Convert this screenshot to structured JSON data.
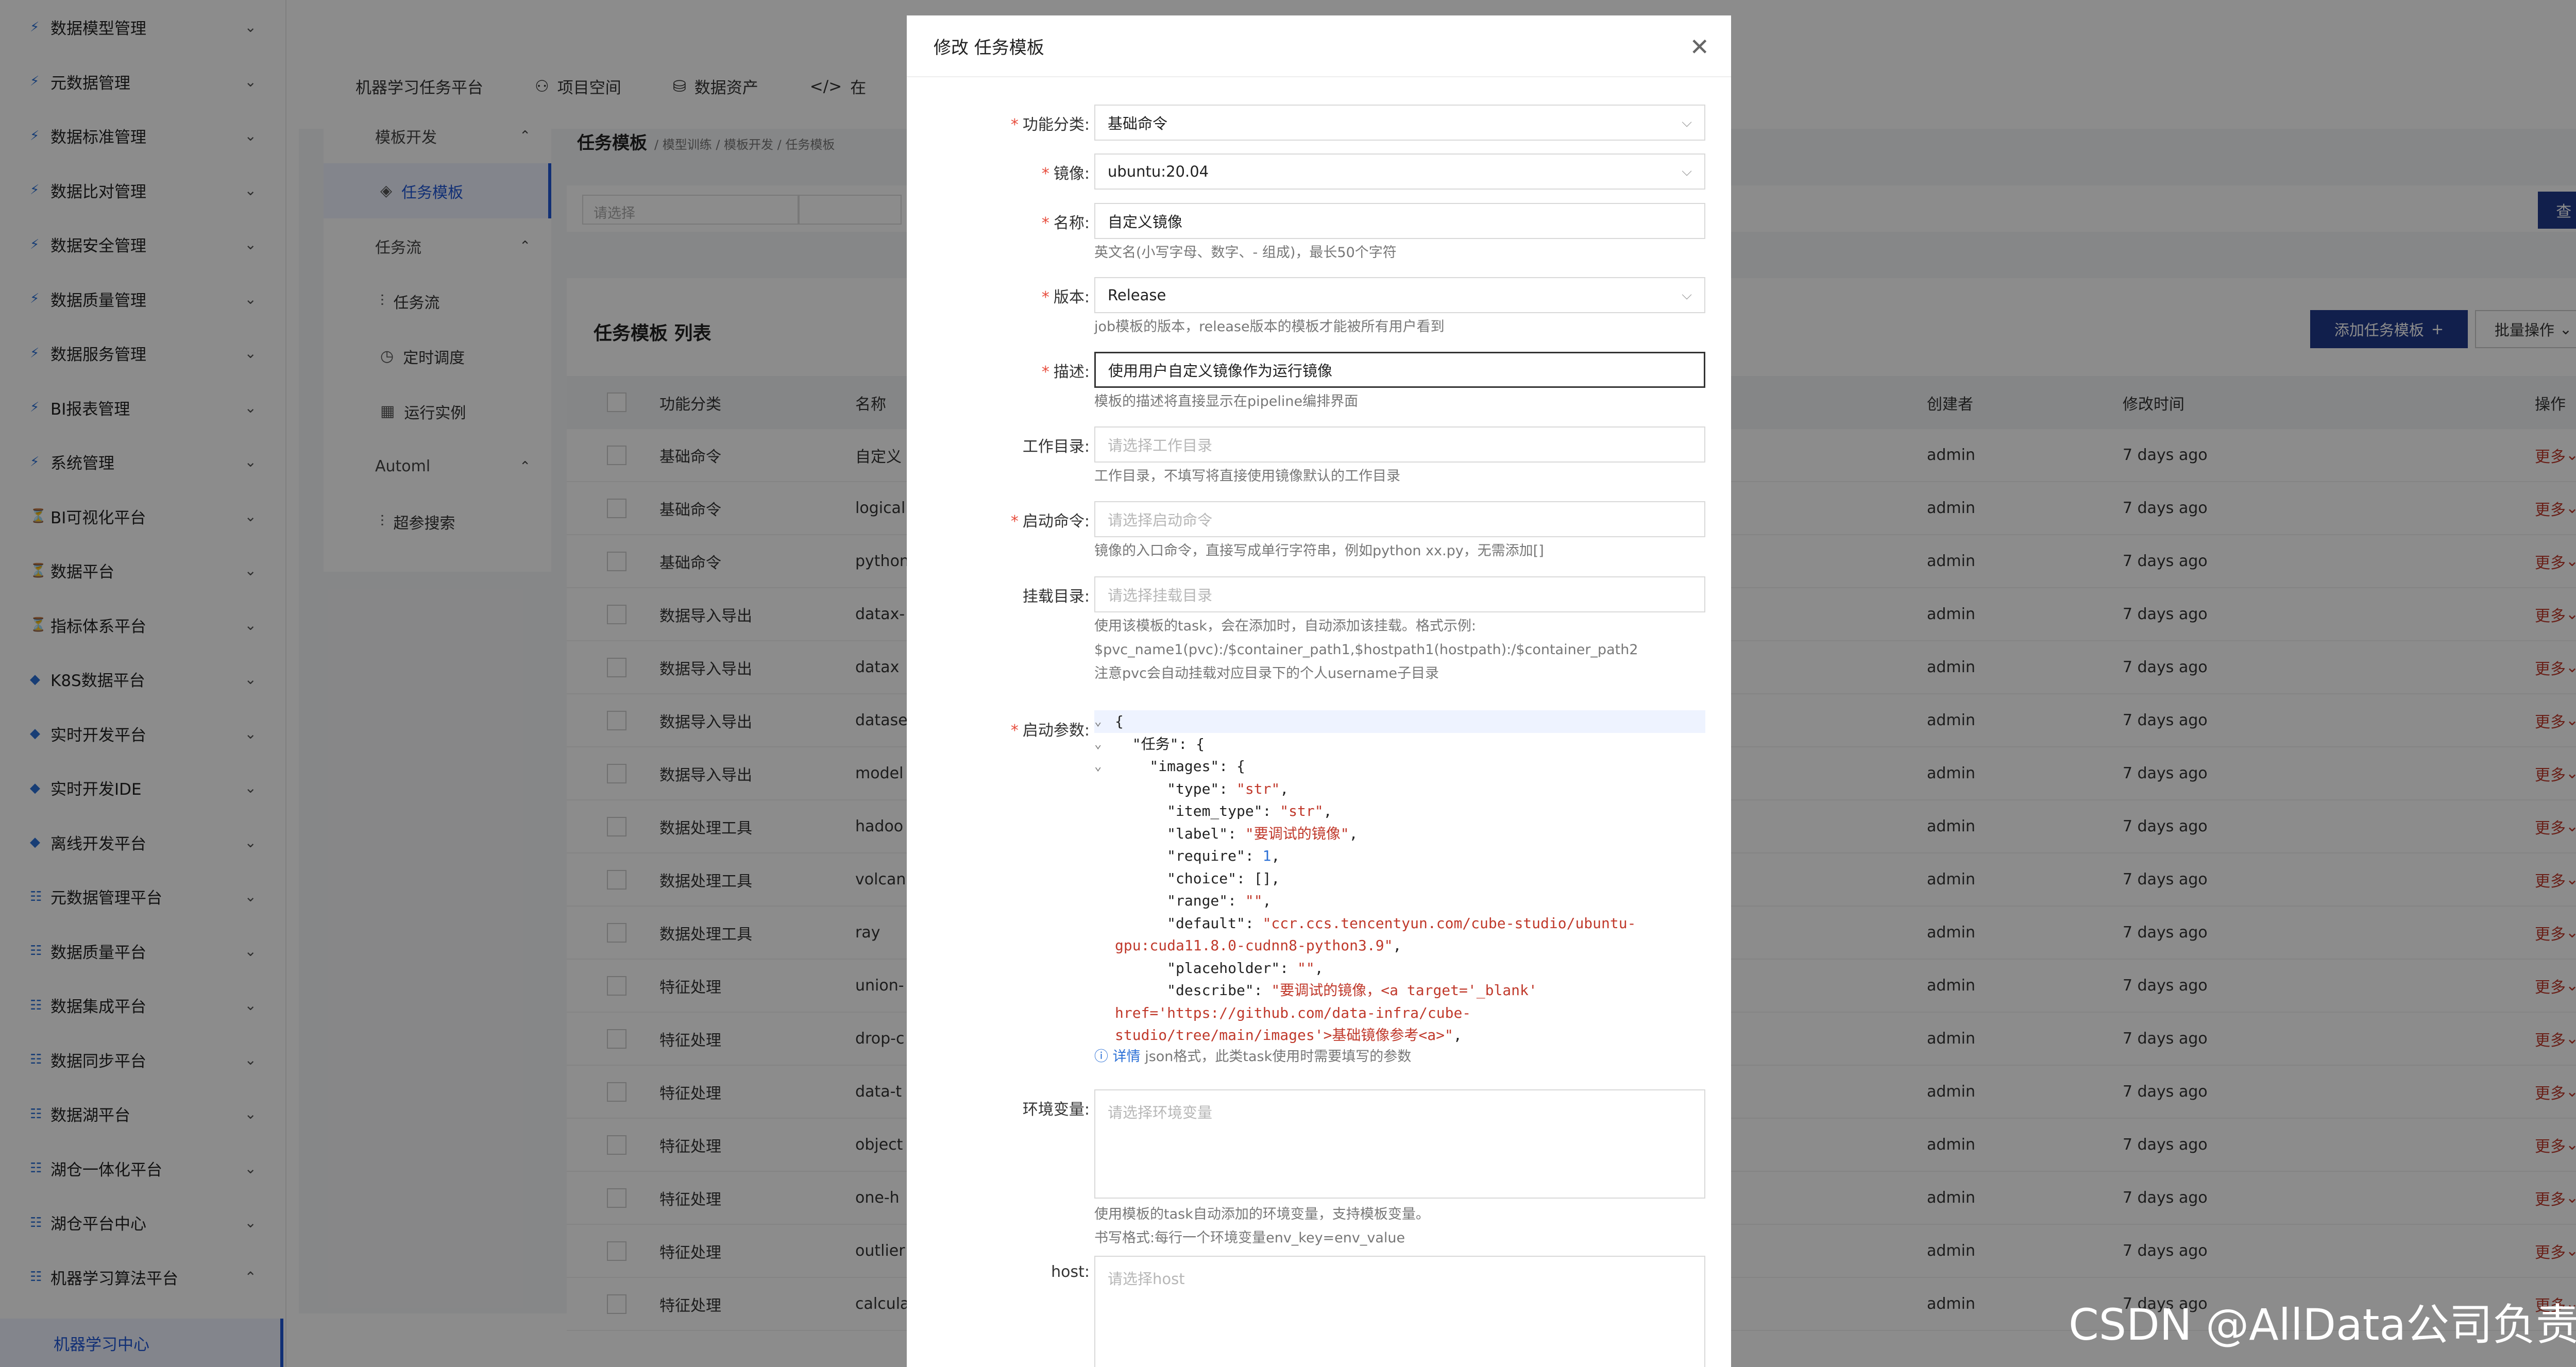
{
  "sidebar": {
    "items": [
      {
        "label": "数据模型管理",
        "icon": "⚡"
      },
      {
        "label": "元数据管理",
        "icon": "⚡"
      },
      {
        "label": "数据标准管理",
        "icon": "⚡"
      },
      {
        "label": "数据比对管理",
        "icon": "⚡"
      },
      {
        "label": "数据安全管理",
        "icon": "⚡"
      },
      {
        "label": "数据质量管理",
        "icon": "⚡"
      },
      {
        "label": "数据服务管理",
        "icon": "⚡"
      },
      {
        "label": "BI报表管理",
        "icon": "⚡"
      },
      {
        "label": "系统管理",
        "icon": "⚡"
      },
      {
        "label": "BI可视化平台",
        "icon": "⏳"
      },
      {
        "label": "数据平台",
        "icon": "⏳"
      },
      {
        "label": "指标体系平台",
        "icon": "⏳"
      },
      {
        "label": "K8S数据平台",
        "icon": "◆"
      },
      {
        "label": "实时开发平台",
        "icon": "◆"
      },
      {
        "label": "实时开发IDE",
        "icon": "◆"
      },
      {
        "label": "离线开发平台",
        "icon": "◆"
      },
      {
        "label": "元数据管理平台",
        "icon": "☷"
      },
      {
        "label": "数据质量平台",
        "icon": "☷"
      },
      {
        "label": "数据集成平台",
        "icon": "☷"
      },
      {
        "label": "数据同步平台",
        "icon": "☷"
      },
      {
        "label": "数据湖平台",
        "icon": "☷"
      },
      {
        "label": "湖仓一体化平台",
        "icon": "☷"
      },
      {
        "label": "湖仓平台中心",
        "icon": "☷"
      },
      {
        "label": "机器学习算法平台",
        "icon": "☷"
      }
    ],
    "sub_active": "机器学习中心"
  },
  "topnav": {
    "items": [
      "机器学习任务平台",
      "项目空间",
      "数据资产",
      "在"
    ]
  },
  "subnav": {
    "group1": "模板开发",
    "item1": "任务模板",
    "group2": "任务流",
    "item2": "任务流",
    "item3": "定时调度",
    "item4": "运行实例",
    "group3": "Automl",
    "item5": "超参搜索"
  },
  "main": {
    "title": "任务模板",
    "breadcrumb": "/ 模型训练 / 模板开发 / 任务模板",
    "filter_placeholder": "请选择",
    "query": "查 询",
    "table_title": "任务模板 列表",
    "add_button": "添加任务模板",
    "bulk_button": "批量操作"
  },
  "table": {
    "headers": [
      "功能分类",
      "名称",
      "创建者",
      "修改时间",
      "操作"
    ],
    "rows": [
      {
        "category": "基础命令",
        "name": "自定义",
        "creator": "admin",
        "time": "7 days ago",
        "op": "更多"
      },
      {
        "category": "基础命令",
        "name": "logical",
        "creator": "admin",
        "time": "7 days ago",
        "op": "更多"
      },
      {
        "category": "基础命令",
        "name": "python",
        "creator": "admin",
        "time": "7 days ago",
        "op": "更多"
      },
      {
        "category": "数据导入导出",
        "name": "datax-",
        "creator": "admin",
        "time": "7 days ago",
        "op": "更多"
      },
      {
        "category": "数据导入导出",
        "name": "datax",
        "creator": "admin",
        "time": "7 days ago",
        "op": "更多"
      },
      {
        "category": "数据导入导出",
        "name": "datase",
        "creator": "admin",
        "time": "7 days ago",
        "op": "更多"
      },
      {
        "category": "数据导入导出",
        "name": "model",
        "creator": "admin",
        "time": "7 days ago",
        "op": "更多"
      },
      {
        "category": "数据处理工具",
        "name": "hadoo",
        "creator": "admin",
        "time": "7 days ago",
        "op": "更多"
      },
      {
        "category": "数据处理工具",
        "name": "volcan",
        "creator": "admin",
        "time": "7 days ago",
        "op": "更多"
      },
      {
        "category": "数据处理工具",
        "name": "ray",
        "creator": "admin",
        "time": "7 days ago",
        "op": "更多"
      },
      {
        "category": "特征处理",
        "name": "union-",
        "creator": "admin",
        "time": "7 days ago",
        "op": "更多"
      },
      {
        "category": "特征处理",
        "name": "drop-c",
        "creator": "admin",
        "time": "7 days ago",
        "op": "更多"
      },
      {
        "category": "特征处理",
        "name": "data-t",
        "creator": "admin",
        "time": "7 days ago",
        "op": "更多"
      },
      {
        "category": "特征处理",
        "name": "object",
        "creator": "admin",
        "time": "7 days ago",
        "op": "更多"
      },
      {
        "category": "特征处理",
        "name": "one-h",
        "creator": "admin",
        "time": "7 days ago",
        "op": "更多"
      },
      {
        "category": "特征处理",
        "name": "outlier",
        "creator": "admin",
        "time": "7 days ago",
        "op": "更多"
      },
      {
        "category": "特征处理",
        "name": "calcula",
        "creator": "admin",
        "time": "7 days ago",
        "op": "更多"
      }
    ]
  },
  "modal": {
    "title": "修改 任务模板",
    "fields": {
      "category": {
        "label": "功能分类:",
        "value": "基础命令"
      },
      "image": {
        "label": "镜像:",
        "value": "ubuntu:20.04"
      },
      "name": {
        "label": "名称:",
        "value": "自定义镜像",
        "help": "英文名(小写字母、数字、- 组成)，最长50个字符"
      },
      "version": {
        "label": "版本:",
        "value": "Release",
        "help": "job模板的版本，release版本的模板才能被所有用户看到"
      },
      "desc": {
        "label": "描述:",
        "value": "使用用户自定义镜像作为运行镜像",
        "help": "模板的描述将直接显示在pipeline编排界面"
      },
      "workdir": {
        "label": "工作目录:",
        "placeholder": "请选择工作目录",
        "help": "工作目录，不填写将直接使用镜像默认的工作目录"
      },
      "command": {
        "label": "启动命令:",
        "placeholder": "请选择启动命令",
        "help": "镜像的入口命令，直接写成单行字符串，例如python xx.py，无需添加[]"
      },
      "mount": {
        "label": "挂载目录:",
        "placeholder": "请选择挂载目录",
        "help1": "使用该模板的task，会在添加时，自动添加该挂载。格式示例:",
        "help2": "$pvc_name1(pvc):/$container_path1,$hostpath1(hostpath):/$container_path2",
        "help3": "注意pvc会自动挂载对应目录下的个人username子目录"
      },
      "args": {
        "label": "启动参数:",
        "detail": "详情",
        "help": "json格式，此类task使用时需要填写的参数"
      },
      "env": {
        "label": "环境变量:",
        "placeholder": "请选择环境变量",
        "help1": "使用模板的task自动添加的环境变量，支持模板变量。",
        "help2": "书写格式:每行一个环境变量env_key=env_value"
      },
      "host": {
        "label": "host:",
        "placeholder": "请选择host"
      }
    }
  },
  "watermark": "CSDN @AllData公司负责人"
}
